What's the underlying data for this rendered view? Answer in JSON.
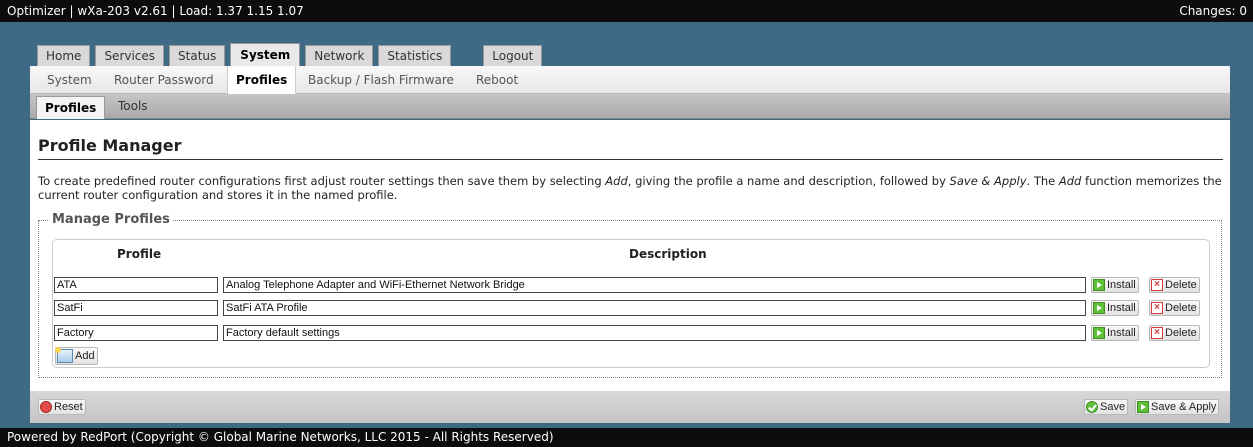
{
  "topbar": {
    "title": "Optimizer | wXa-203 v2.61 | Load: 1.37 1.15 1.07",
    "changes": "Changes: 0"
  },
  "main_tabs": [
    "Home",
    "Services",
    "Status",
    "System",
    "Network",
    "Statistics",
    "Logout"
  ],
  "main_tab_active": "System",
  "sub_tabs": [
    "System",
    "Router Password",
    "Profiles",
    "Backup / Flash Firmware",
    "Reboot"
  ],
  "sub_tab_active": "Profiles",
  "sub2_tabs": [
    "Profiles",
    "Tools"
  ],
  "sub2_tab_active": "Profiles",
  "page": {
    "heading": "Profile Manager",
    "description": {
      "part1": "To create predefined router configurations first adjust router settings then save them by selecting ",
      "add1": "Add",
      "part2": ", giving the profile a name and description, followed by ",
      "save_apply": "Save & Apply",
      "part3": ". The ",
      "add2": "Add",
      "part4": " function memorizes the current router configuration and stores it in the named profile."
    }
  },
  "manage": {
    "legend": "Manage Profiles",
    "col_profile": "Profile",
    "col_description": "Description",
    "rows": [
      {
        "profile": "ATA",
        "description": "Analog Telephone Adapter and WiFi-Ethernet Network Bridge"
      },
      {
        "profile": "SatFi",
        "description": "SatFi ATA Profile"
      },
      {
        "profile": "Factory",
        "description": "Factory default settings"
      }
    ],
    "install_label": "Install",
    "delete_label": "Delete",
    "add_label": "Add"
  },
  "actions": {
    "reset_label": "Reset",
    "save_label": "Save",
    "save_apply_label": "Save & Apply"
  },
  "footer": {
    "text": "Powered by RedPort (Copyright © Global Marine Networks, LLC 2015 - All Rights Reserved)"
  }
}
